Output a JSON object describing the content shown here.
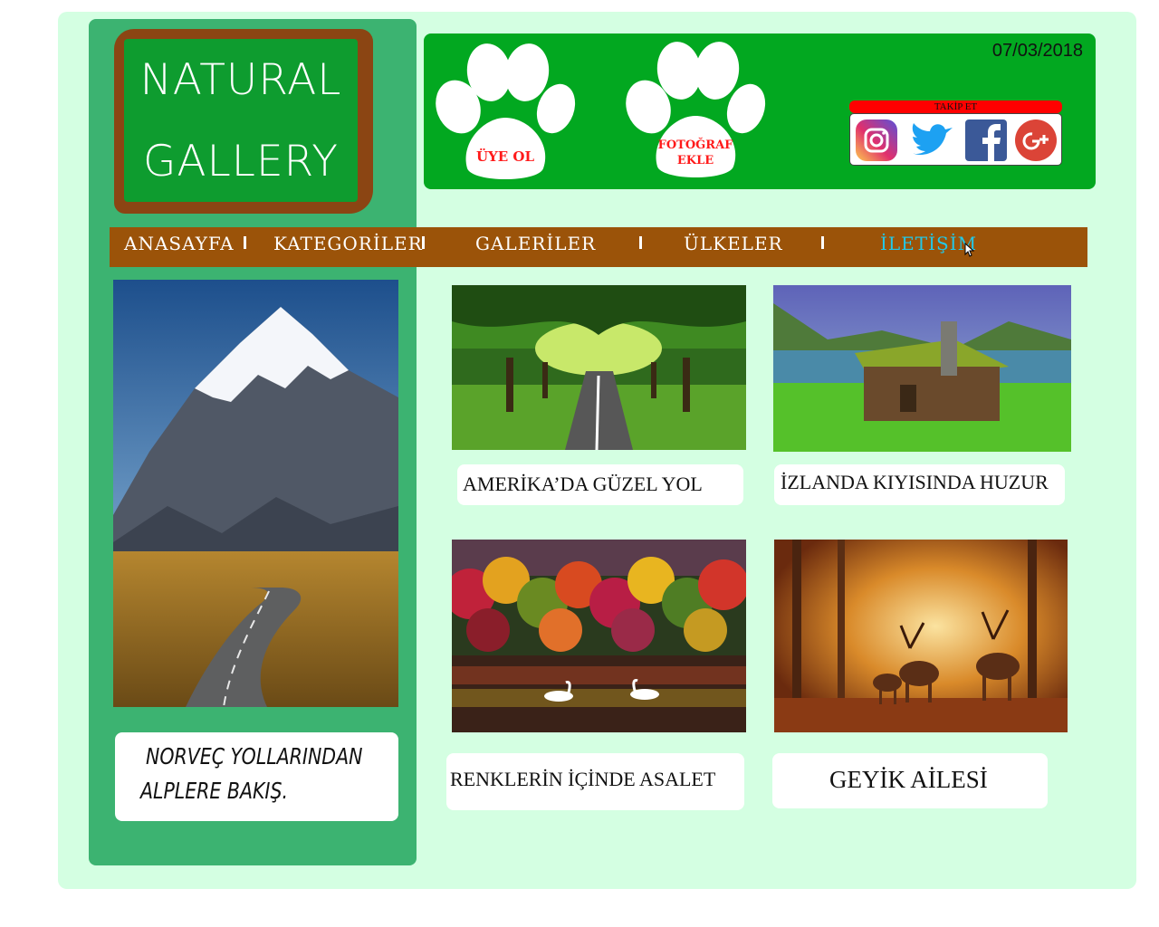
{
  "logo": {
    "line1": "NATURAL",
    "line2": "GALLERY"
  },
  "header": {
    "date": "07/03/2018",
    "signup_label": "ÜYE OL",
    "add_photo_label_line1": "FOTOĞRAF",
    "add_photo_label_line2": "EKLE",
    "follow_label": "TAKİP ET",
    "social_icons": [
      "instagram-icon",
      "twitter-icon",
      "facebook-icon",
      "google-plus-icon"
    ]
  },
  "nav": {
    "items": [
      {
        "label": "ANASAYFA"
      },
      {
        "label": "KATEGORİLER"
      },
      {
        "label": "GALERİLER"
      },
      {
        "label": "ÜLKELER"
      },
      {
        "label": "İLETİŞİM"
      }
    ],
    "active_index": 4
  },
  "sidebar": {
    "caption_line1": "NORVEÇ YOLLARINDAN",
    "caption_line2": "ALPLERE BAKIŞ."
  },
  "gallery": [
    {
      "caption": "AMERİKA’DA GÜZEL YOL"
    },
    {
      "caption": "İZLANDA KIYISINDA HUZUR"
    },
    {
      "caption": "RENKLERİN İÇİNDE ASALET"
    },
    {
      "caption": "GEYİK AİLESİ"
    }
  ],
  "colors": {
    "page_background": "#d4ffe2",
    "sidebar": "#3cb371",
    "header": "#02a820",
    "nav": "#9b5309",
    "nav_active": "#22c8e8",
    "paw_label": "#ff1a1a"
  }
}
